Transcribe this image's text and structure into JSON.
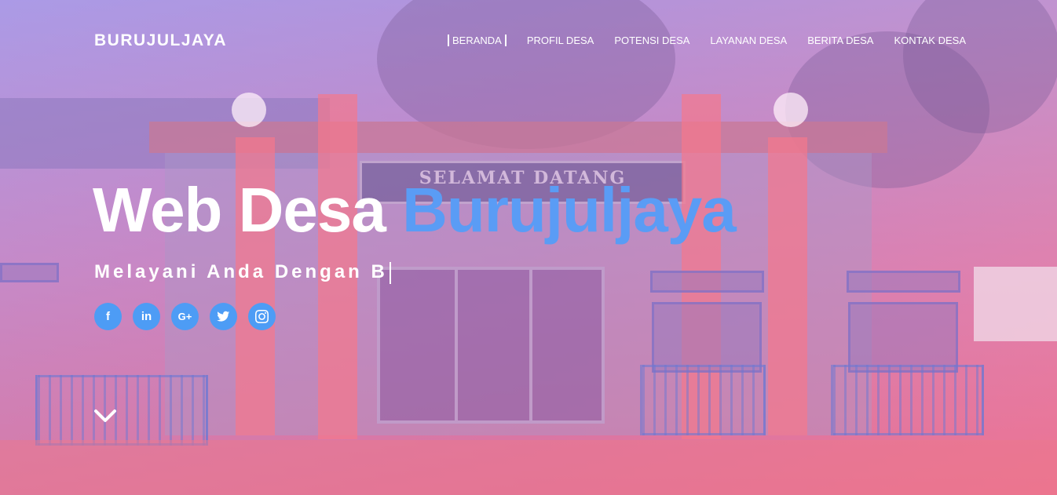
{
  "brand": "BURUJULJAYA",
  "menu": [
    {
      "label": "BERANDA",
      "active": true
    },
    {
      "label": "PROFIL DESA"
    },
    {
      "label": "POTENSI DESA"
    },
    {
      "label": "LAYANAN DESA"
    },
    {
      "label": "BERITA DESA"
    },
    {
      "label": "KONTAK DESA"
    }
  ],
  "hero": {
    "title_main": "Web Desa ",
    "title_accent": "Burujuljaya",
    "subtitle": "Melayani Anda Dengan B",
    "sign_text": "SELAMAT DATANG"
  },
  "social": {
    "facebook": "f",
    "linkedin": "in",
    "googleplus": "G+",
    "twitter_icon": "twitter-icon",
    "instagram_icon": "instagram-icon"
  },
  "colors": {
    "accent": "#5a9cf5",
    "social_bg": "#4d9cf5",
    "text": "#ffffff"
  }
}
